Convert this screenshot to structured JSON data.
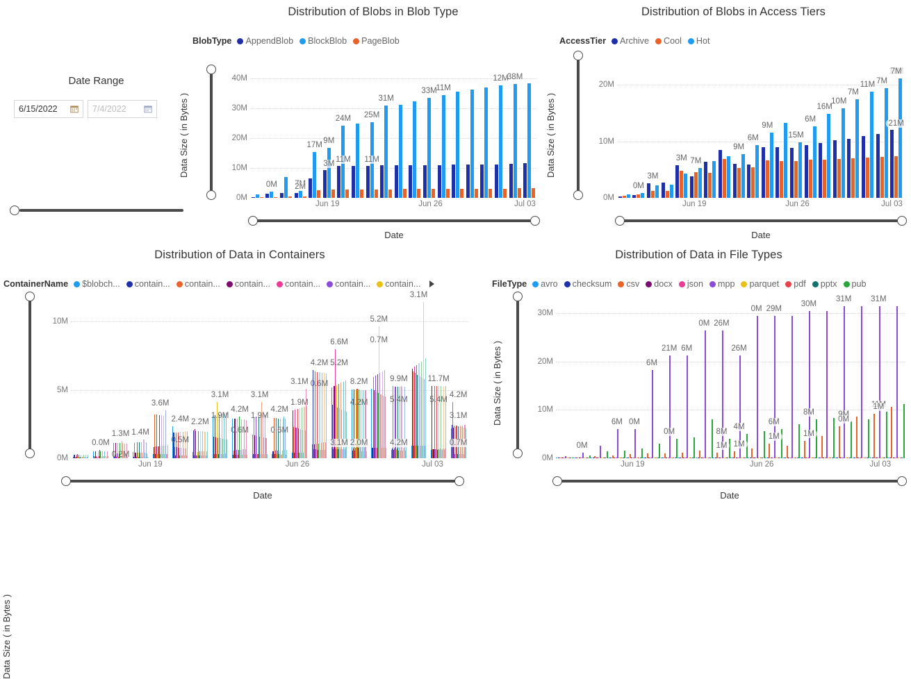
{
  "slicer": {
    "title": "Date Range",
    "start_value": "6/15/2022",
    "end_value": "7/4/2022",
    "start_icon": "calendar-icon",
    "end_icon": "calendar-icon"
  },
  "charts": [
    {
      "id": "blob-type",
      "title": "Distribution of Blobs in Blob Type",
      "legend_title": "BlobType",
      "legend": [
        {
          "label": "AppendBlob",
          "color": "#1f2fa8"
        },
        {
          "label": "BlockBlob",
          "color": "#1f9bf0"
        },
        {
          "label": "PageBlob",
          "color": "#e8622a"
        }
      ],
      "has_legend_more": false,
      "ylabel": "Data Size ( in Bytes )",
      "xlabel": "Date",
      "yticks": [
        "0M",
        "10M",
        "20M",
        "30M",
        "40M"
      ],
      "xticks": [
        "Jun 19",
        "Jun 26",
        "Jul 03"
      ],
      "chart_data": {
        "type": "bar",
        "title": "Distribution of Blobs in Blob Type",
        "xlabel": "Date",
        "ylabel": "Data Size ( in Bytes )",
        "ylim": [
          0,
          43
        ],
        "yticks": [
          0,
          10,
          20,
          30,
          40
        ],
        "grid": true,
        "legend_position": "top-left",
        "categories": [
          "1",
          "2",
          "3",
          "4",
          "5",
          "6",
          "7",
          "8",
          "9",
          "10",
          "11",
          "12",
          "13",
          "14",
          "15",
          "16",
          "17",
          "18",
          "19",
          "20"
        ],
        "series": [
          {
            "name": "AppendBlob",
            "color": "#1f2fa8",
            "values": [
              0.3,
              1.4,
              1.6,
              1.6,
              6.6,
              9.2,
              10.6,
              10.8,
              10.8,
              10.9,
              10.9,
              11.0,
              11.0,
              11.0,
              11.1,
              11.1,
              11.1,
              11.2,
              11.5,
              11.7
            ]
          },
          {
            "name": "BlockBlob",
            "color": "#1f9bf0",
            "values": [
              1.1,
              2.0,
              6.9,
              2.3,
              15.4,
              16.8,
              24.1,
              24.8,
              25.4,
              31.0,
              31.2,
              32.2,
              33.4,
              34.5,
              35.6,
              36.3,
              37.0,
              37.6,
              38.1,
              38.4
            ]
          },
          {
            "name": "PageBlob",
            "color": "#e8622a",
            "values": [
              0.2,
              0.3,
              0.4,
              0.5,
              2.6,
              2.7,
              2.8,
              2.8,
              2.9,
              2.9,
              3.0,
              3.0,
              3.0,
              3.0,
              3.1,
              3.1,
              3.1,
              3.1,
              3.2,
              3.2
            ]
          }
        ],
        "labels": [
          {
            "index": 1,
            "text": "0M"
          },
          {
            "index": 3,
            "text": "7M"
          },
          {
            "index": 3,
            "text": "2M"
          },
          {
            "index": 4,
            "text": "17M"
          },
          {
            "index": 5,
            "text": "9M"
          },
          {
            "index": 6,
            "text": "24M"
          },
          {
            "index": 8,
            "text": "25M"
          },
          {
            "index": 9,
            "text": "31M"
          },
          {
            "index": 12,
            "text": "33M"
          },
          {
            "index": 18,
            "text": "38M"
          },
          {
            "index": 6,
            "text": "11M"
          },
          {
            "index": 8,
            "text": "11M"
          },
          {
            "index": 13,
            "text": "11M"
          },
          {
            "index": 17,
            "text": "12M"
          },
          {
            "index": 5,
            "text": "3M"
          }
        ]
      }
    },
    {
      "id": "access-tiers",
      "title": "Distribution of Blobs in Access Tiers",
      "legend_title": "AccessTier",
      "legend": [
        {
          "label": "Archive",
          "color": "#1f2fa8"
        },
        {
          "label": "Cool",
          "color": "#e8622a"
        },
        {
          "label": "Hot",
          "color": "#1f9bf0"
        }
      ],
      "has_legend_more": false,
      "ylabel": "Data Size ( in Bytes )",
      "xlabel": "Date",
      "yticks": [
        "0M",
        "10M",
        "20M"
      ],
      "xticks": [
        "Jun 19",
        "Jun 26",
        "Jul 03"
      ],
      "chart_data": {
        "type": "bar",
        "title": "Distribution of Blobs in Access Tiers",
        "xlabel": "Date",
        "ylabel": "Data Size ( in Bytes )",
        "ylim": [
          0,
          23
        ],
        "yticks": [
          0,
          10,
          20
        ],
        "grid": true,
        "legend_position": "top-left",
        "categories": [
          "1",
          "2",
          "3",
          "4",
          "5",
          "6",
          "7",
          "8",
          "9",
          "10",
          "11",
          "12",
          "13",
          "14",
          "15",
          "16",
          "17",
          "18",
          "19",
          "20"
        ],
        "series": [
          {
            "name": "Archive",
            "color": "#1f2fa8",
            "values": [
              0.3,
              0.5,
              2.6,
              2.7,
              5.8,
              3.9,
              6.5,
              8.6,
              6.1,
              6.0,
              9.1,
              9.1,
              8.9,
              9.4,
              9.8,
              10.3,
              10.6,
              11.1,
              11.5,
              12.2
            ]
          },
          {
            "name": "Cool",
            "color": "#e8622a",
            "values": [
              0.4,
              0.6,
              1.3,
              1.3,
              4.9,
              4.6,
              4.5,
              7.0,
              5.4,
              5.5,
              6.7,
              6.6,
              6.6,
              6.8,
              6.9,
              7.0,
              7.1,
              7.2,
              7.3,
              7.4
            ]
          },
          {
            "name": "Hot",
            "color": "#1f9bf0",
            "values": [
              0.6,
              0.9,
              2.2,
              2.4,
              4.4,
              5.3,
              6.6,
              7.4,
              7.8,
              9.4,
              11.7,
              13.4,
              10.0,
              12.8,
              15.0,
              16.1,
              17.6,
              19.0,
              19.6,
              21.4
            ]
          }
        ],
        "labels": [
          {
            "index": 1,
            "text": "0M"
          },
          {
            "index": 2,
            "text": "3M"
          },
          {
            "index": 4,
            "text": "3M"
          },
          {
            "index": 5,
            "text": "7M"
          },
          {
            "index": 8,
            "text": "9M"
          },
          {
            "index": 9,
            "text": "6M"
          },
          {
            "index": 10,
            "text": "9M"
          },
          {
            "index": 12,
            "text": "15M"
          },
          {
            "index": 13,
            "text": "6M"
          },
          {
            "index": 14,
            "text": "16M"
          },
          {
            "index": 15,
            "text": "10M"
          },
          {
            "index": 16,
            "text": "7M"
          },
          {
            "index": 17,
            "text": "11M"
          },
          {
            "index": 18,
            "text": "7M"
          },
          {
            "index": 19,
            "text": "11M"
          },
          {
            "index": 19,
            "text": "21M"
          },
          {
            "index": 19,
            "text": "7M"
          }
        ]
      }
    },
    {
      "id": "containers",
      "title": "Distribution of Data in Containers",
      "legend_title": "ContainerName",
      "legend": [
        {
          "label": "$blobch...",
          "color": "#1f9bf0"
        },
        {
          "label": "contain...",
          "color": "#1f2fa8"
        },
        {
          "label": "contain...",
          "color": "#e8622a"
        },
        {
          "label": "contain...",
          "color": "#7d0b6e"
        },
        {
          "label": "contain...",
          "color": "#ea3c96"
        },
        {
          "label": "contain...",
          "color": "#8a4bdb"
        },
        {
          "label": "contain...",
          "color": "#e8c018"
        }
      ],
      "has_legend_more": true,
      "ylabel": "Data Size ( in Bytes )",
      "xlabel": "Date",
      "yticks": [
        "0M",
        "5M",
        "10M"
      ],
      "xticks": [
        "Jun 19",
        "Jun 26",
        "Jul 03"
      ],
      "chart_data": {
        "type": "bar",
        "title": "Distribution of Data in Containers",
        "xlabel": "Date",
        "ylabel": "Data Size ( in Bytes )",
        "ylim": [
          0,
          12.5
        ],
        "yticks": [
          0,
          5,
          10
        ],
        "grid": true,
        "legend_position": "top-left",
        "note": "Many container series rendered as dense thin multicolour bars per date",
        "categories": [
          "1",
          "2",
          "3",
          "4",
          "5",
          "6",
          "7",
          "8",
          "9",
          "10",
          "11",
          "12",
          "13",
          "14",
          "15",
          "16",
          "17",
          "18",
          "19",
          "20"
        ],
        "peak_values": [
          0.3,
          0.6,
          1.3,
          1.4,
          3.6,
          2.4,
          2.2,
          4.2,
          3.1,
          4.2,
          3.1,
          5.2,
          6.6,
          8.2,
          5.2,
          9.9,
          5.4,
          11.7,
          5.4,
          4.2
        ],
        "labels": [
          {
            "index": 1,
            "text": "0.0M"
          },
          {
            "index": 2,
            "text": "1.3M"
          },
          {
            "index": 2,
            "text": "0.2M"
          },
          {
            "index": 3,
            "text": "1.4M"
          },
          {
            "index": 4,
            "text": "3.6M"
          },
          {
            "index": 5,
            "text": "2.4M"
          },
          {
            "index": 5,
            "text": "0.5M"
          },
          {
            "index": 6,
            "text": "2.2M"
          },
          {
            "index": 7,
            "text": "3.1M"
          },
          {
            "index": 7,
            "text": "1.9M"
          },
          {
            "index": 8,
            "text": "4.2M"
          },
          {
            "index": 8,
            "text": "0.6M"
          },
          {
            "index": 9,
            "text": "3.1M"
          },
          {
            "index": 9,
            "text": "1.9M"
          },
          {
            "index": 10,
            "text": "4.2M"
          },
          {
            "index": 10,
            "text": "0.6M"
          },
          {
            "index": 11,
            "text": "3.1M"
          },
          {
            "index": 11,
            "text": "1.9M"
          },
          {
            "index": 12,
            "text": "4.2M"
          },
          {
            "index": 12,
            "text": "0.6M"
          },
          {
            "index": 13,
            "text": "6.6M"
          },
          {
            "index": 13,
            "text": "5.2M"
          },
          {
            "index": 13,
            "text": "3.1M"
          },
          {
            "index": 14,
            "text": "8.2M"
          },
          {
            "index": 14,
            "text": "4.2M"
          },
          {
            "index": 14,
            "text": "2.0M"
          },
          {
            "index": 15,
            "text": "5.2M"
          },
          {
            "index": 15,
            "text": "0.7M"
          },
          {
            "index": 16,
            "text": "9.9M"
          },
          {
            "index": 16,
            "text": "5.4M"
          },
          {
            "index": 16,
            "text": "4.2M"
          },
          {
            "index": 17,
            "text": "3.1M"
          },
          {
            "index": 18,
            "text": "11.7M"
          },
          {
            "index": 18,
            "text": "5.4M"
          },
          {
            "index": 19,
            "text": "4.2M"
          },
          {
            "index": 19,
            "text": "3.1M"
          },
          {
            "index": 19,
            "text": "0.7M"
          }
        ]
      }
    },
    {
      "id": "file-types",
      "title": "Distribution of Data in File Types",
      "legend_title": "FileType",
      "legend": [
        {
          "label": "avro",
          "color": "#1f9bf0"
        },
        {
          "label": "checksum",
          "color": "#1f2fa8"
        },
        {
          "label": "csv",
          "color": "#e8622a"
        },
        {
          "label": "docx",
          "color": "#7d0b6e"
        },
        {
          "label": "json",
          "color": "#ea3c96"
        },
        {
          "label": "mpp",
          "color": "#8a4bdb"
        },
        {
          "label": "parquet",
          "color": "#e8c018"
        },
        {
          "label": "pdf",
          "color": "#e8434a"
        },
        {
          "label": "pptx",
          "color": "#12726e"
        },
        {
          "label": "pub",
          "color": "#2aa73c"
        }
      ],
      "has_legend_more": false,
      "ylabel": "Data Size ( in Bytes )",
      "xlabel": "Date",
      "yticks": [
        "0M",
        "10M",
        "20M",
        "30M"
      ],
      "xticks": [
        "Jun 19",
        "Jun 26",
        "Jul 03"
      ],
      "chart_data": {
        "type": "bar",
        "title": "Distribution of Data in File Types",
        "xlabel": "Date",
        "ylabel": "Data Size ( in Bytes )",
        "ylim": [
          0,
          34
        ],
        "yticks": [
          0,
          10,
          20,
          30
        ],
        "grid": true,
        "legend_position": "top-left",
        "categories": [
          "1",
          "2",
          "3",
          "4",
          "5",
          "6",
          "7",
          "8",
          "9",
          "10",
          "11",
          "12",
          "13",
          "14",
          "15",
          "16",
          "17",
          "18",
          "19",
          "20"
        ],
        "series": [
          {
            "name": "mpp",
            "color": "#8a4bdb",
            "values": [
              0.4,
              1.1,
              2.5,
              6.0,
              6.0,
              18.0,
              21.0,
              21.0,
              26.0,
              26.0,
              21.0,
              29.0,
              29.0,
              29.0,
              30.0,
              30.0,
              31.0,
              31.0,
              31.0,
              31.0
            ]
          },
          {
            "name": "pub",
            "color": "#2aa73c",
            "values": [
              0.2,
              0.6,
              1.4,
              1.5,
              2.0,
              3.0,
              4.0,
              4.2,
              8.0,
              4.0,
              5.0,
              5.5,
              6.0,
              7.0,
              8.0,
              8.2,
              7.5,
              8.0,
              9.5,
              11.0
            ]
          },
          {
            "name": "csv",
            "color": "#e8622a",
            "values": [
              0.1,
              0.2,
              0.4,
              0.5,
              0.8,
              1.0,
              1.0,
              1.1,
              1.5,
              1.2,
              1.4,
              2.0,
              3.0,
              2.5,
              3.5,
              4.5,
              6.5,
              8.5,
              9.0,
              10.5
            ]
          }
        ],
        "labels": [
          {
            "index": 1,
            "text": "0M"
          },
          {
            "index": 3,
            "text": "6M"
          },
          {
            "index": 4,
            "text": "0M"
          },
          {
            "index": 5,
            "text": "6M"
          },
          {
            "index": 6,
            "text": "21M"
          },
          {
            "index": 6,
            "text": "0M"
          },
          {
            "index": 7,
            "text": "6M"
          },
          {
            "index": 8,
            "text": "0M"
          },
          {
            "index": 9,
            "text": "26M"
          },
          {
            "index": 9,
            "text": "8M"
          },
          {
            "index": 9,
            "text": "1M"
          },
          {
            "index": 10,
            "text": "26M"
          },
          {
            "index": 10,
            "text": "4M"
          },
          {
            "index": 10,
            "text": "1M"
          },
          {
            "index": 11,
            "text": "0M"
          },
          {
            "index": 12,
            "text": "29M"
          },
          {
            "index": 12,
            "text": "6M"
          },
          {
            "index": 12,
            "text": "1M"
          },
          {
            "index": 14,
            "text": "30M"
          },
          {
            "index": 14,
            "text": "8M"
          },
          {
            "index": 14,
            "text": "1M"
          },
          {
            "index": 16,
            "text": "31M"
          },
          {
            "index": 16,
            "text": "9M"
          },
          {
            "index": 16,
            "text": "0M"
          },
          {
            "index": 18,
            "text": "31M"
          },
          {
            "index": 18,
            "text": "11M"
          },
          {
            "index": 18,
            "text": "1M"
          }
        ]
      }
    }
  ]
}
